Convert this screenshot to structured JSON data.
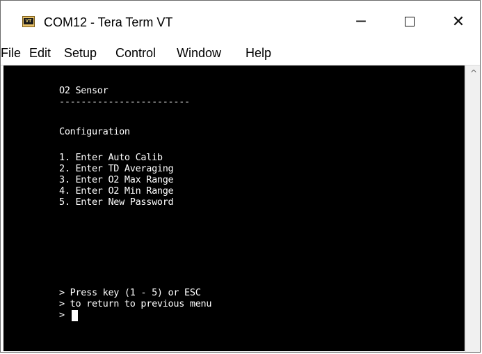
{
  "window": {
    "title": "COM12 - Tera Term VT",
    "icon_label": "VT",
    "controls": {
      "minimize": "─",
      "close": "✕"
    }
  },
  "menubar": {
    "items": [
      "File",
      "Edit",
      "Setup",
      "Control",
      "Window",
      "Help"
    ]
  },
  "terminal": {
    "heading": "O2 Sensor",
    "separator": "------------------------",
    "section": "Configuration",
    "options": [
      "1. Enter Auto Calib",
      "2. Enter TD Averaging",
      "3. Enter O2 Max Range",
      "4. Enter O2 Min Range",
      "5. Enter New Password"
    ],
    "prompt_line1": "> Press key (1 - 5) or ESC",
    "prompt_line2": "> to return to previous menu",
    "prompt_line3": ">"
  },
  "scrollbar": {
    "up_arrow": "^"
  },
  "colors": {
    "terminal_bg": "#000000",
    "terminal_fg": "#ffffff",
    "chrome_bg": "#ffffff"
  }
}
